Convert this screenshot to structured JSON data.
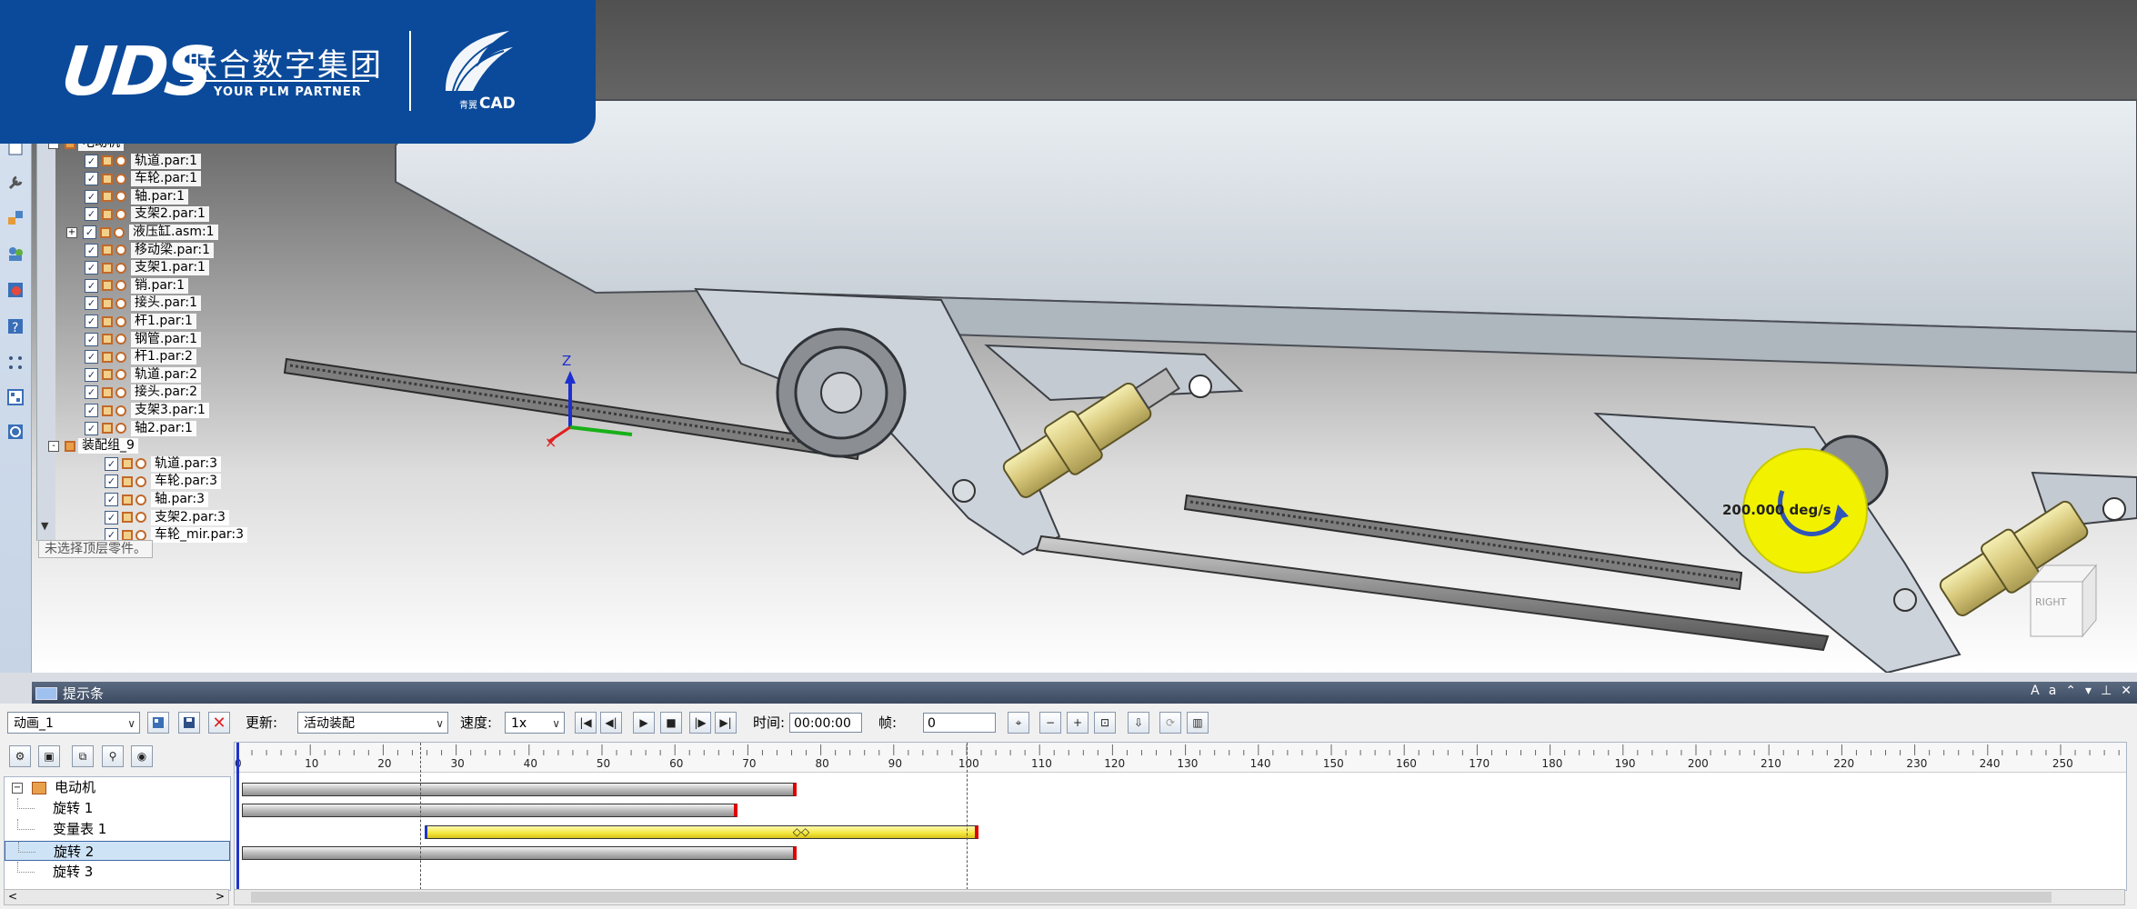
{
  "logo": {
    "brand": "UDS",
    "company_cn": "联合数字集团",
    "tagline": "YOUR PLM PARTNER",
    "product": "CAD",
    "product_prefix": "青翼"
  },
  "viewport": {
    "axis_label": "Z",
    "speed_callout": "200.000 deg/s",
    "view_cube_label": "RIGHT"
  },
  "feature_tree": {
    "items": [
      {
        "label": "电动机",
        "level": 0,
        "expander": "-"
      },
      {
        "label": "轨道.par:1",
        "level": 1
      },
      {
        "label": "车轮.par:1",
        "level": 1
      },
      {
        "label": "轴.par:1",
        "level": 1
      },
      {
        "label": "支架2.par:1",
        "level": 1
      },
      {
        "label": "液压缸.asm:1",
        "level": 1,
        "expander": "+"
      },
      {
        "label": "移动梁.par:1",
        "level": 1
      },
      {
        "label": "支架1.par:1",
        "level": 1
      },
      {
        "label": "销.par:1",
        "level": 1
      },
      {
        "label": "接头.par:1",
        "level": 1
      },
      {
        "label": "杆1.par:1",
        "level": 1
      },
      {
        "label": "钢管.par:1",
        "level": 1
      },
      {
        "label": "杆1.par:2",
        "level": 1
      },
      {
        "label": "轨道.par:2",
        "level": 1
      },
      {
        "label": "接头.par:2",
        "level": 1
      },
      {
        "label": "支架3.par:1",
        "level": 1
      },
      {
        "label": "轴2.par:1",
        "level": 1
      },
      {
        "label": "装配组_9",
        "level": 0,
        "expander": "-"
      },
      {
        "label": "轨道.par:3",
        "level": 2
      },
      {
        "label": "车轮.par:3",
        "level": 2
      },
      {
        "label": "轴.par:3",
        "level": 2
      },
      {
        "label": "支架2.par:3",
        "level": 2
      },
      {
        "label": "车轮_mir.par:3",
        "level": 2
      }
    ],
    "status_text": "未选择顶层零件。"
  },
  "hint_bar": {
    "title": "提示条"
  },
  "animation": {
    "name_select": "动画_1",
    "update_label": "更新:",
    "update_value": "活动装配",
    "speed_label": "速度:",
    "speed_value": "1x",
    "time_label": "时间:",
    "time_value": "00:00:00",
    "frame_label": "帧:",
    "frame_value": "0",
    "tree": [
      {
        "label": "电动机",
        "root": true
      },
      {
        "label": "旋转 1"
      },
      {
        "label": "变量表 1"
      },
      {
        "label": "旋转 2",
        "selected": true
      },
      {
        "label": "旋转 3"
      }
    ],
    "ruler_ticks": [
      "0",
      "10",
      "20",
      "30",
      "40",
      "50",
      "60",
      "70",
      "80",
      "90",
      "100",
      "110",
      "120",
      "130",
      "140",
      "150",
      "160",
      "170",
      "180",
      "190",
      "200",
      "210",
      "220",
      "230",
      "240",
      "250"
    ],
    "tracks": [
      {
        "name": "旋转 1",
        "start": 0,
        "end": 76,
        "color": "gray"
      },
      {
        "name": "变量表 1",
        "start": 0,
        "end": 68,
        "color": "gray"
      },
      {
        "name": "旋转 2",
        "start": 25,
        "end": 101,
        "color": "yellow"
      },
      {
        "name": "旋转 3",
        "start": 0,
        "end": 76,
        "color": "gray"
      }
    ],
    "markers": [
      25,
      100
    ]
  },
  "colors": {
    "logo_blue": "#0b4a9a",
    "callout_yellow": "#f2f200",
    "bar_end_red": "#e00000"
  }
}
